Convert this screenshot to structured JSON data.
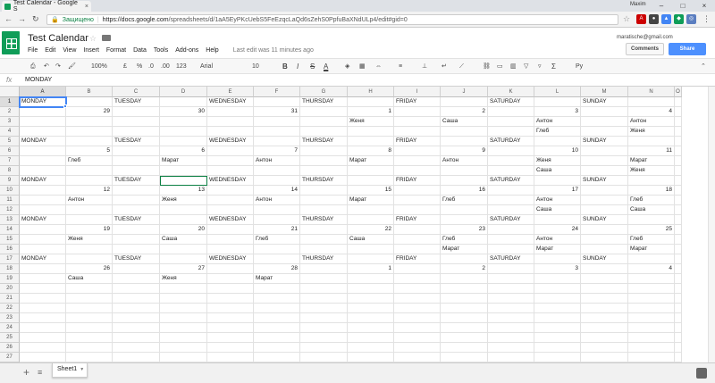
{
  "browser": {
    "tab_title": "Test Calendar - Google S",
    "tab_close": "×",
    "user": "Maxim",
    "secure_label": "Защищено",
    "url_host": "https://docs.google.com",
    "url_path": "/spreadsheets/d/1aA5EyPKcUebS5FeEzqcLaQd6sZehS0PpfuBaXNdULp4/edit#gid=0"
  },
  "sheets": {
    "title": "Test Calendar",
    "menu": [
      "File",
      "Edit",
      "View",
      "Insert",
      "Format",
      "Data",
      "Tools",
      "Add-ons",
      "Help"
    ],
    "last_edit": "Last edit was 11 minutes ago",
    "account": "maratische@gmail.com",
    "comments": "Comments",
    "share": "Share"
  },
  "toolbar": {
    "zoom": "100%",
    "currency": "£",
    "percent": "%",
    "dec0": ".0",
    "dec00": ".00",
    "format123": "123",
    "font": "Arial",
    "size": "10",
    "bold": "B",
    "italic": "I",
    "strike": "S",
    "textcolor": "A",
    "sigma": "Σ",
    "input_tools": "Ру"
  },
  "formula_bar": {
    "fx": "fx",
    "value": "MONDAY"
  },
  "columns": [
    "A",
    "B",
    "C",
    "D",
    "E",
    "F",
    "G",
    "H",
    "I",
    "J",
    "K",
    "L",
    "M",
    "N",
    "O"
  ],
  "rows": [
    "1",
    "2",
    "3",
    "4",
    "5",
    "6",
    "7",
    "8",
    "9",
    "10",
    "11",
    "12",
    "13",
    "14",
    "15",
    "16",
    "17",
    "18",
    "19",
    "20",
    "21",
    "22",
    "23",
    "24",
    "25",
    "26",
    "27"
  ],
  "cells": {
    "A1": "MONDAY",
    "C1": "TUESDAY",
    "E1": "WEDNESDAY",
    "G1": "THURSDAY",
    "I1": "FRIDAY",
    "K1": "SATURDAY",
    "M1": "SUNDAY",
    "B2": "29",
    "D2": "30",
    "F2": "31",
    "H2": "1",
    "J2": "2",
    "L2": "3",
    "N2": "4",
    "H3": "Женя",
    "J3": "Саша",
    "L3": "Антон",
    "N3": "Антон",
    "L4": "Глеб",
    "N4": "Женя",
    "A5": "MONDAY",
    "C5": "TUESDAY",
    "E5": "WEDNESDAY",
    "G5": "THURSDAY",
    "I5": "FRIDAY",
    "K5": "SATURDAY",
    "M5": "SUNDAY",
    "B6": "5",
    "D6": "6",
    "F6": "7",
    "H6": "8",
    "J6": "9",
    "L6": "10",
    "N6": "11",
    "B7": "Глеб",
    "D7": "Марат",
    "F7": "Антон",
    "H7": "Марат",
    "J7": "Антон",
    "L7": "Женя",
    "N7": "Марат",
    "L8": "Саша",
    "N8": "Женя",
    "A9": "MONDAY",
    "C9": "TUESDAY",
    "E9": "WEDNESDAY",
    "G9": "THURSDAY",
    "I9": "FRIDAY",
    "K9": "SATURDAY",
    "M9": "SUNDAY",
    "B10": "12",
    "D10": "13",
    "F10": "14",
    "H10": "15",
    "J10": "16",
    "L10": "17",
    "N10": "18",
    "B11": "Антон",
    "D11": "Женя",
    "F11": "Антон",
    "H11": "Марат",
    "J11": "Глеб",
    "L11": "Антон",
    "N11": "Глеб",
    "L12": "Саша",
    "N12": "Саша",
    "A13": "MONDAY",
    "C13": "TUESDAY",
    "E13": "WEDNESDAY",
    "G13": "THURSDAY",
    "I13": "FRIDAY",
    "K13": "SATURDAY",
    "M13": "SUNDAY",
    "B14": "19",
    "D14": "20",
    "F14": "21",
    "H14": "22",
    "J14": "23",
    "L14": "24",
    "N14": "25",
    "B15": "Женя",
    "D15": "Саша",
    "F15": "Глеб",
    "H15": "Саша",
    "J15": "Глеб",
    "L15": "Антон",
    "N15": "Глеб",
    "J16": "Марат",
    "L16": "Марат",
    "N16": "Марат",
    "A17": "MONDAY",
    "C17": "TUESDAY",
    "E17": "WEDNESDAY",
    "G17": "THURSDAY",
    "I17": "FRIDAY",
    "K17": "SATURDAY",
    "M17": "SUNDAY",
    "B18": "26",
    "D18": "27",
    "F18": "28",
    "H18": "1",
    "J18": "2",
    "L18": "3",
    "N18": "4",
    "B19": "Саша",
    "D19": "Женя",
    "F19": "Марат"
  },
  "sheet_tab": "Sheet1",
  "colors": {
    "accent": "#4285f4",
    "sheets_green": "#0f9d58",
    "share": "#4d90fe"
  }
}
